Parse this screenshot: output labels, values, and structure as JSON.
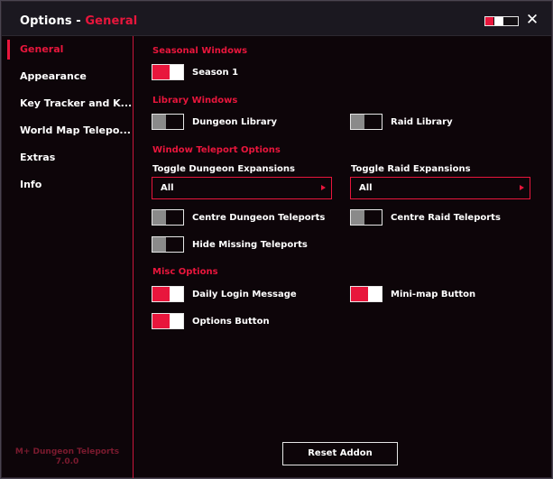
{
  "window": {
    "title_prefix": "Options - ",
    "title_section": "General",
    "close_icon": "close-icon"
  },
  "sidebar": {
    "items": [
      {
        "label": "General",
        "active": true
      },
      {
        "label": "Appearance",
        "active": false
      },
      {
        "label": "Key Tracker and K...",
        "active": false
      },
      {
        "label": "World Map Telepo...",
        "active": false
      },
      {
        "label": "Extras",
        "active": false
      },
      {
        "label": "Info",
        "active": false
      }
    ],
    "footer_name": "M+ Dungeon Teleports",
    "footer_version": "7.0.0"
  },
  "main": {
    "seasonal": {
      "heading": "Seasonal Windows",
      "season1": {
        "label": "Season 1",
        "on": true
      }
    },
    "library": {
      "heading": "Library Windows",
      "dungeon": {
        "label": "Dungeon Library",
        "on": false
      },
      "raid": {
        "label": "Raid Library",
        "on": false
      }
    },
    "teleport": {
      "heading": "Window Teleport Options",
      "dungeon_exp_label": "Toggle Dungeon Expansions",
      "dungeon_exp_value": "All",
      "raid_exp_label": "Toggle Raid Expansions",
      "raid_exp_value": "All",
      "centre_dungeon": {
        "label": "Centre Dungeon Teleports",
        "on": false
      },
      "centre_raid": {
        "label": "Centre Raid Teleports",
        "on": false
      },
      "hide_missing": {
        "label": "Hide Missing Teleports",
        "on": false
      }
    },
    "misc": {
      "heading": "Misc Options",
      "daily_login": {
        "label": "Daily Login Message",
        "on": true
      },
      "minimap": {
        "label": "Mini-map Button",
        "on": true
      },
      "options_button": {
        "label": "Options Button",
        "on": true
      }
    },
    "reset_label": "Reset Addon"
  },
  "colors": {
    "accent": "#e8163c",
    "background": "#0d0509",
    "titlebar": "#1b1820"
  }
}
